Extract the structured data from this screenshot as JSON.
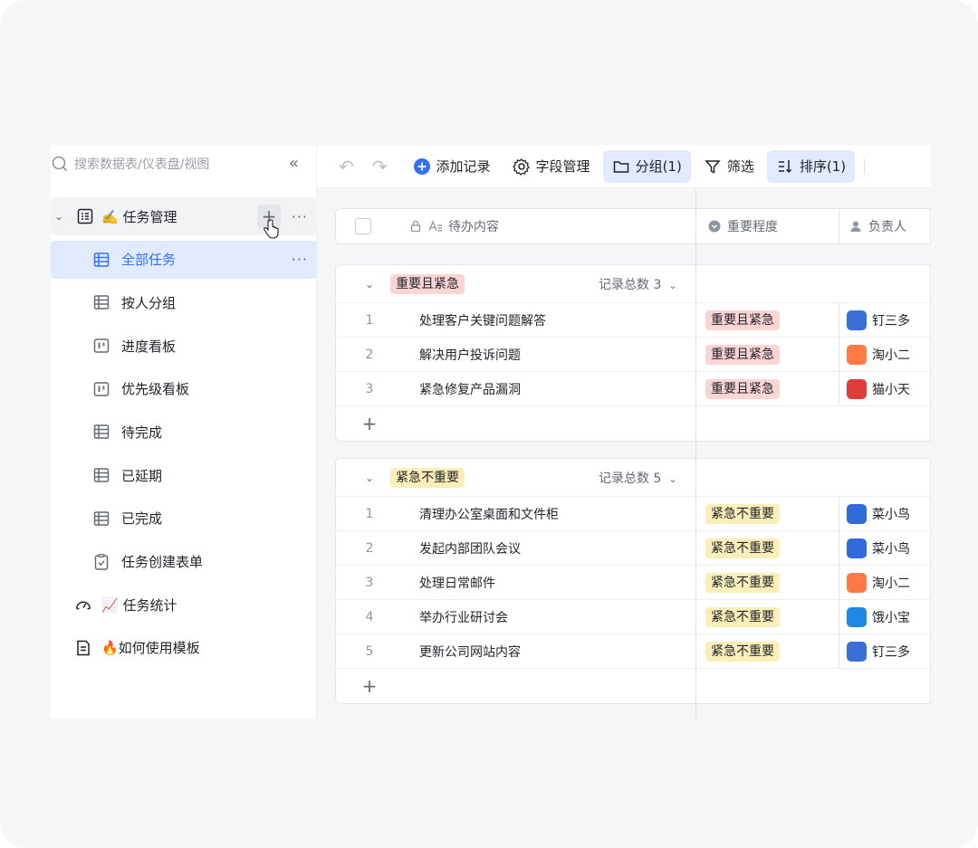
{
  "sidebar": {
    "search_placeholder": "搜索数据表/仪表盘/视图",
    "root": {
      "label": "✍️ 任务管理"
    },
    "views": [
      {
        "label": "全部任务",
        "icon": "grid-table-icon",
        "active": true
      },
      {
        "label": "按人分组",
        "icon": "grid-table-icon"
      },
      {
        "label": "进度看板",
        "icon": "kanban-icon"
      },
      {
        "label": "优先级看板",
        "icon": "kanban-icon"
      },
      {
        "label": "待完成",
        "icon": "grid-table-icon"
      },
      {
        "label": "已延期",
        "icon": "grid-table-icon"
      },
      {
        "label": "已完成",
        "icon": "grid-table-icon"
      },
      {
        "label": "任务创建表单",
        "icon": "form-icon"
      }
    ],
    "top_items": [
      {
        "label": "📈 任务统计",
        "icon": "dashboard-icon"
      },
      {
        "label": "🔥如何使用模板",
        "icon": "document-icon"
      }
    ]
  },
  "toolbar": {
    "add_record": "添加记录",
    "field_manage": "字段管理",
    "group": "分组(1)",
    "filter": "筛选",
    "sort": "排序(1)"
  },
  "table": {
    "columns": {
      "title": "待办内容",
      "priority": "重要程度",
      "owner": "负责人"
    },
    "groups": [
      {
        "name": "重要且紧急",
        "color": "#fbd4d4",
        "count_label": "记录总数 3",
        "rows": [
          {
            "num": "1",
            "title": "处理客户关键问题解答",
            "priority": "重要且紧急",
            "owner": "钉三多",
            "avatar_color": "#3a6fd8"
          },
          {
            "num": "2",
            "title": "解决用户投诉问题",
            "priority": "重要且紧急",
            "owner": "淘小二",
            "avatar_color": "#ff7a45"
          },
          {
            "num": "3",
            "title": "紧急修复产品漏洞",
            "priority": "重要且紧急",
            "owner": "猫小天",
            "avatar_color": "#e03b3b"
          }
        ]
      },
      {
        "name": "紧急不重要",
        "color": "#faeeb9",
        "count_label": "记录总数 5",
        "rows": [
          {
            "num": "1",
            "title": "清理办公室桌面和文件柜",
            "priority": "紧急不重要",
            "owner": "菜小鸟",
            "avatar_color": "#2f6bd9"
          },
          {
            "num": "2",
            "title": "发起内部团队会议",
            "priority": "紧急不重要",
            "owner": "菜小鸟",
            "avatar_color": "#2f6bd9"
          },
          {
            "num": "3",
            "title": "处理日常邮件",
            "priority": "紧急不重要",
            "owner": "淘小二",
            "avatar_color": "#ff7a45"
          },
          {
            "num": "4",
            "title": "举办行业研讨会",
            "priority": "紧急不重要",
            "owner": "饿小宝",
            "avatar_color": "#1e88e5"
          },
          {
            "num": "5",
            "title": "更新公司网站内容",
            "priority": "紧急不重要",
            "owner": "钉三多",
            "avatar_color": "#3a6fd8"
          }
        ]
      }
    ]
  }
}
